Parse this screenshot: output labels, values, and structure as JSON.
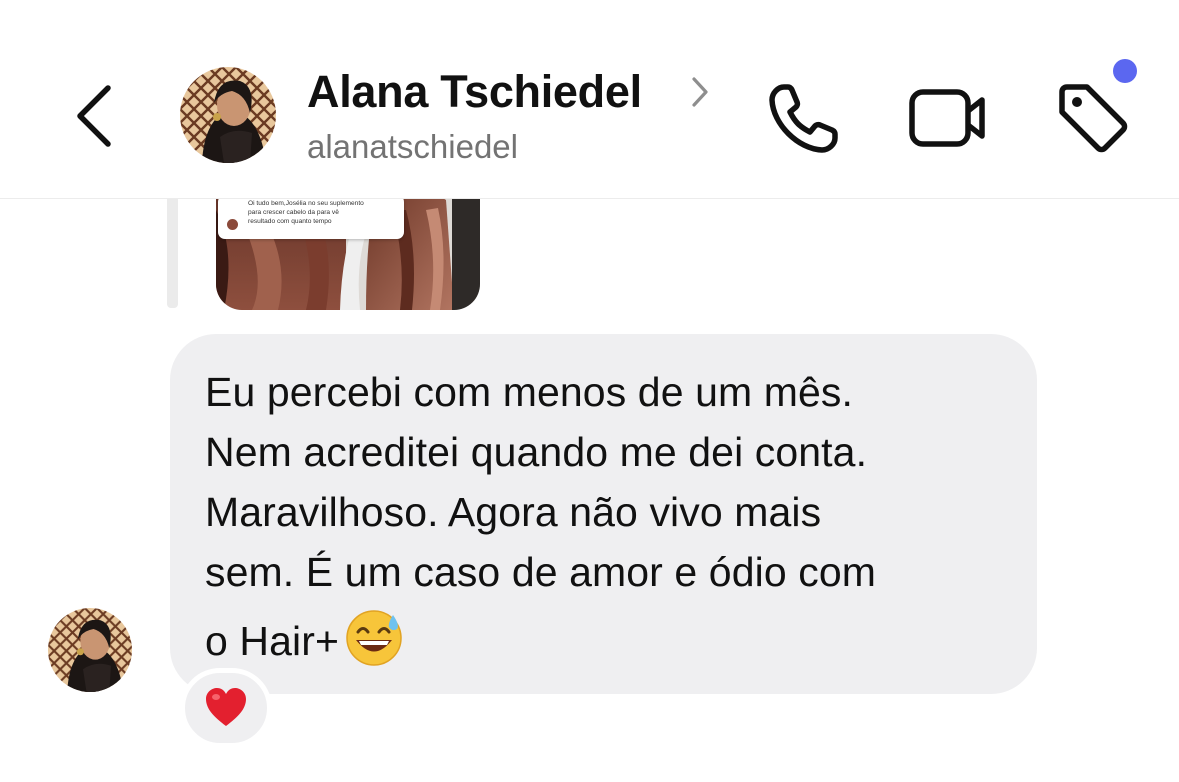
{
  "header": {
    "back_icon": "chevron-left-icon",
    "contact_name": "Alana Tschiedel",
    "contact_handle": "alanatschiedel",
    "name_chevron_icon": "chevron-right-icon",
    "actions": [
      "phone-icon",
      "video-camera-icon",
      "tag-icon"
    ],
    "notification_dot_color": "#5b67f0"
  },
  "shared_image": {
    "caption_lines": [
      "Oi tudo bem,Josélia no seu suplemento",
      "para crescer cabelo da para vê",
      "resultado com quanto tempo"
    ]
  },
  "message": {
    "lines": [
      "Eu percebi com menos de um mês.",
      "Nem acreditei quando me dei conta.",
      "Maravilhoso. Agora não vivo mais",
      "sem. É um caso de amor e ódio com",
      "o Hair+"
    ],
    "emoji": "grinning-face-with-sweat",
    "reaction": "red-heart",
    "bubble_color": "#efeff1"
  }
}
